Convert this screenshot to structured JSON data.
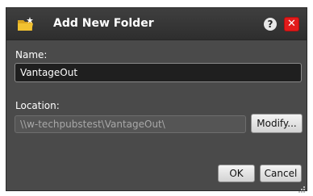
{
  "dialog": {
    "title": "Add New Folder",
    "help_label": "?",
    "close_label": "✕",
    "title_icon": "folder-icon"
  },
  "name": {
    "label": "Name:",
    "value": "VantageOut"
  },
  "location": {
    "label": "Location:",
    "value": "\\\\w-techpubstest\\VantageOut\\",
    "modify_label": "Modify..."
  },
  "footer": {
    "ok_label": "OK",
    "cancel_label": "Cancel"
  },
  "colors": {
    "dialog_bg": "#4a4a4a",
    "titlebar_bg": "#333333",
    "close_red": "#e31b1b",
    "folder_yellow": "#f2c230"
  }
}
